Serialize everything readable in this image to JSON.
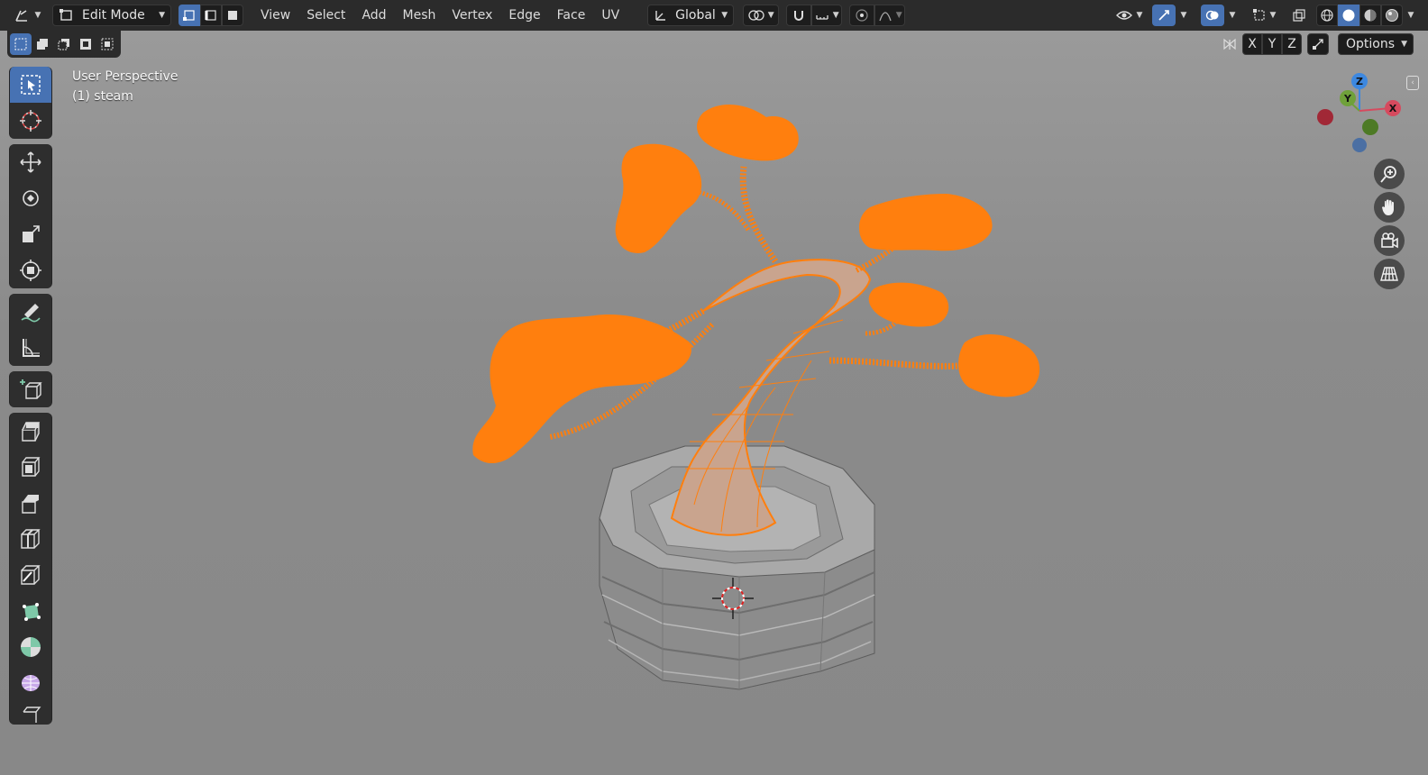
{
  "header": {
    "mode": "Edit Mode",
    "menu": [
      "View",
      "Select",
      "Add",
      "Mesh",
      "Vertex",
      "Edge",
      "Face",
      "UV"
    ],
    "transform_orientation": "Global"
  },
  "subbar": {
    "axes": [
      "X",
      "Y",
      "Z"
    ],
    "options": "Options"
  },
  "viewport": {
    "view_name": "User Perspective",
    "object_name": "(1) steam"
  },
  "gizmo": {
    "z": "Z",
    "y": "Y",
    "x": "X"
  },
  "colors": {
    "selection": "#ff7f0e",
    "active_tool": "#4772b3",
    "header": "#2b2b2b"
  },
  "icons": {
    "tools": [
      "select-box-icon",
      "cursor-icon",
      "move-icon",
      "rotate-icon",
      "scale-icon",
      "transform-icon",
      "annotate-icon",
      "measure-icon",
      "add-cube-icon",
      "extrude-icon",
      "inset-icon",
      "bevel-icon",
      "loop-cut-icon",
      "knife-icon",
      "poly-build-icon",
      "spin-icon",
      "smooth-icon",
      "edge-slide-icon"
    ]
  }
}
